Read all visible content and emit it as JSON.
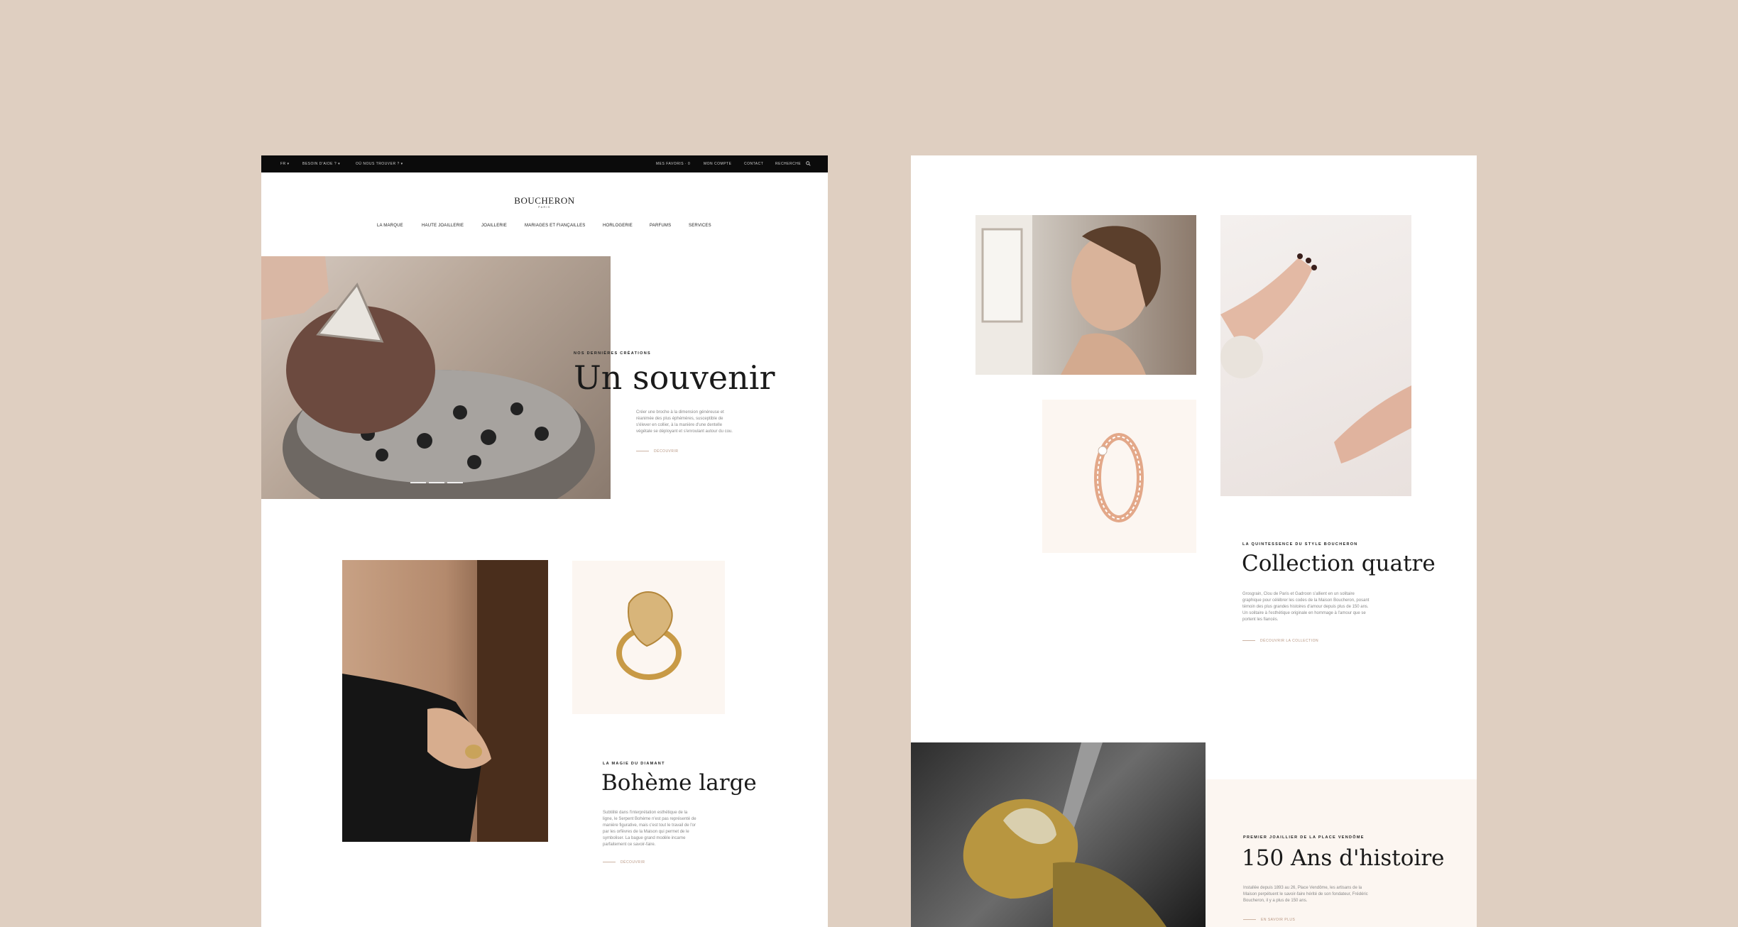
{
  "colors": {
    "background": "#dfcfc1",
    "topbar": "#0b0b0b",
    "accent": "#b79580",
    "cream": "#fcf6f1"
  },
  "left_page": {
    "topbar": {
      "language": "FR ▾",
      "help": "BESOIN D'AIDE ? ▾",
      "find_us": "OÙ NOUS TROUVER ? ▾",
      "favorites": "MES FAVORIS · 0",
      "account": "MON COMPTE",
      "contact": "CONTACT",
      "search": "RECHERCHE",
      "search_icon": "search-icon"
    },
    "logo": {
      "name": "BOUCHERON",
      "sub": "PARIS"
    },
    "nav": [
      "LA MARQUE",
      "HAUTE JOAILLERIE",
      "JOAILLERIE",
      "MARIAGES ET FIANÇAILLES",
      "HORLOGERIE",
      "PARFUMS",
      "SERVICES"
    ],
    "hero": {
      "eyebrow": "NOS DERNIÈRES CRÉATIONS",
      "title": "Un souvenir",
      "text": "Créer une broche à la dimension généreuse et réanimée des plus éphémères, susceptible de s'élever en collier, à la manière d'une dentelle végétale se déployant et s'enroulant autour du cou.",
      "cta": "DÉCOUVRIR"
    },
    "feature": {
      "eyebrow": "LA MAGIE DU DIAMANT",
      "title": "Bohème large",
      "text": "Subtilité dans l'interprétation esthétique de la ligne, le Serpent Bohème n'est pas représenté de manière figurative, mais c'est tout le travail de l'or par les orfèvres de la Maison qui permet de le symboliser. La bague grand modèle incarne parfaitement ce savoir-faire.",
      "cta": "DÉCOUVRIR"
    }
  },
  "right_page": {
    "collection": {
      "eyebrow": "LA QUINTESSENCE DU STYLE BOUCHERON",
      "title": "Collection quatre",
      "text": "Grosgrain, Clou de Paris et Gadroon s'allient en un solitaire graphique pour célébrer les codes de la Maison Boucheron, posant témoin des plus grandes histoires d'amour depuis plus de 150 ans. Un solitaire à l'esthétique originale en hommage à l'amour que se portent les fiancés.",
      "cta": "DÉCOUVRIR LA COLLECTION"
    },
    "history": {
      "eyebrow": "PREMIER JOAILLIER DE LA PLACE VENDÔME",
      "title": "150 Ans d'histoire",
      "text": "Installée depuis 1893 au 26, Place Vendôme, les artisans de la Maison perpétuent le savoir-faire hérité de son fondateur, Frédéric Boucheron, il y a plus de 150 ans.",
      "cta": "EN SAVOIR PLUS"
    }
  }
}
